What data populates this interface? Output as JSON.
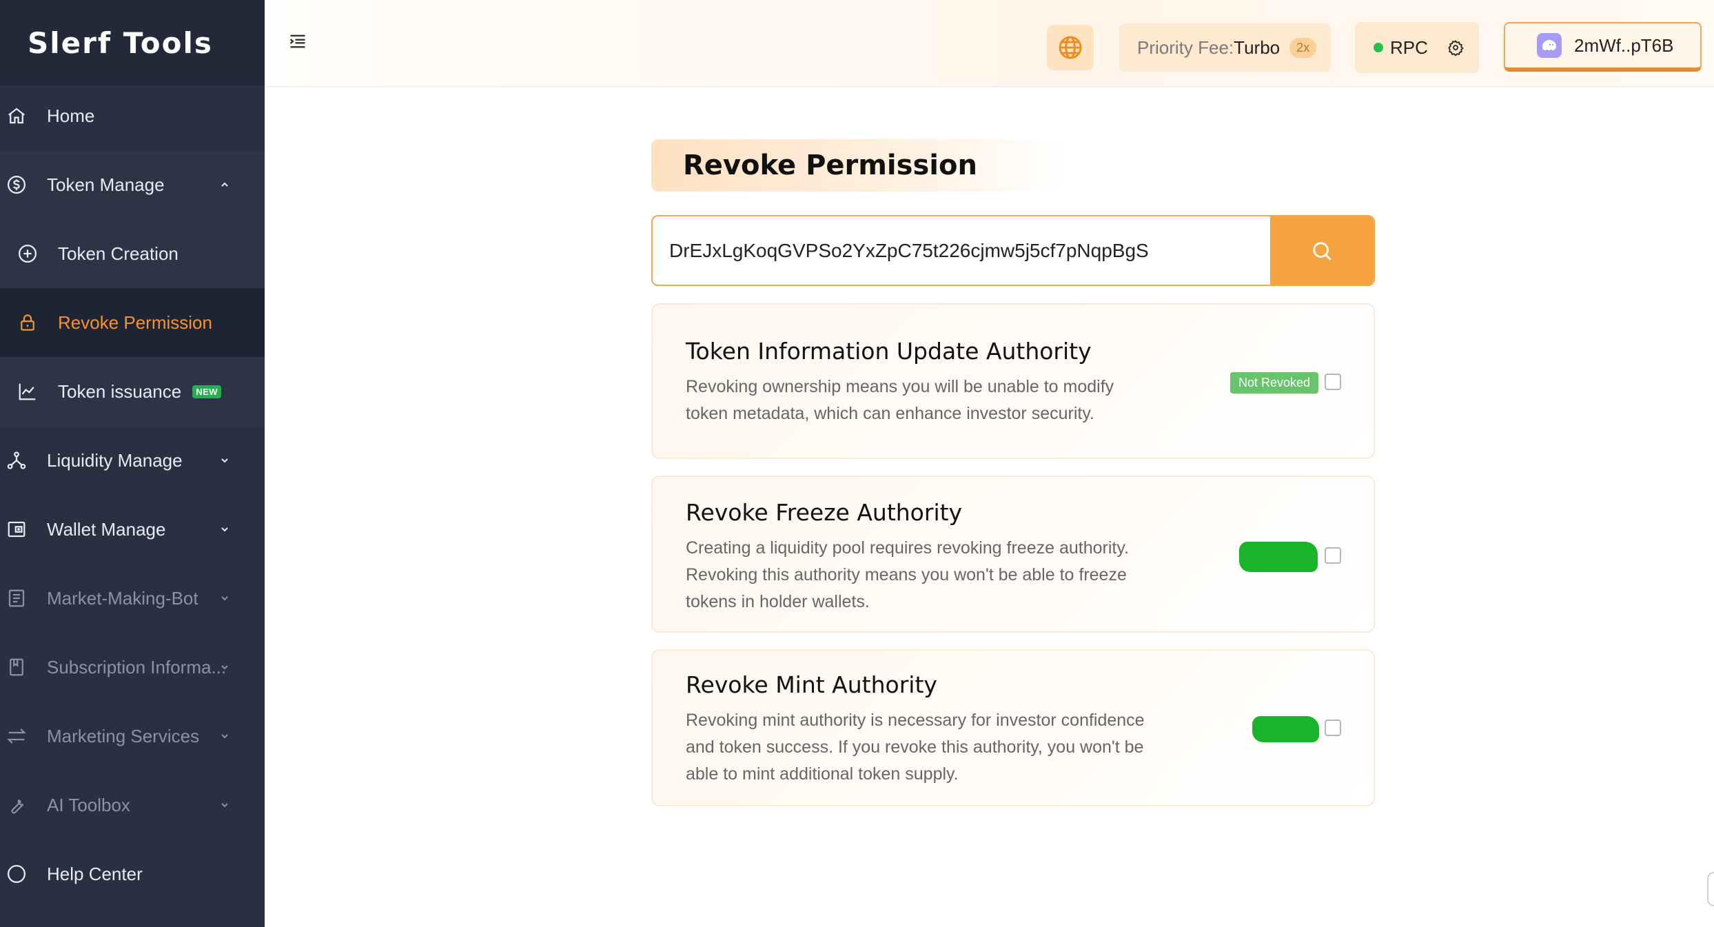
{
  "app": {
    "logo": "Slerf Tools"
  },
  "sidebar": {
    "items": [
      {
        "label": "Home",
        "icon": "home-icon"
      },
      {
        "label": "Token Manage",
        "icon": "dollar-circle-icon"
      },
      {
        "label": "Token Creation",
        "icon": "plus-circle-icon"
      },
      {
        "label": "Revoke Permission",
        "icon": "lock-icon"
      },
      {
        "label": "Token issuance",
        "icon": "chart-line-icon",
        "badge": "NEW"
      },
      {
        "label": "Liquidity Manage",
        "icon": "network-icon"
      },
      {
        "label": "Wallet Manage",
        "icon": "wallet-icon"
      },
      {
        "label": "Market-Making-Bot",
        "icon": "bot-icon"
      },
      {
        "label": "Subscription Informa...",
        "icon": "bookmark-icon"
      },
      {
        "label": "Marketing Services",
        "icon": "swap-icon"
      },
      {
        "label": "AI Toolbox",
        "icon": "wrench-icon"
      },
      {
        "label": "Help Center",
        "icon": "help-icon"
      }
    ]
  },
  "header": {
    "priority_fee_label": "Priority Fee:",
    "priority_fee_value": "Turbo",
    "priority_fee_multiplier": "2x",
    "rpc_label": "RPC",
    "wallet_address": "2mWf..pT6B"
  },
  "main": {
    "title": "Revoke Permission",
    "search_value": "DrEJxLgKoqGVPSo2YxZpC75t226cjmw5j5cf7pNqpBgS",
    "cards": [
      {
        "title": "Token Information Update Authority",
        "description_line1": "Revoking ownership means you will be unable to modify",
        "description_line2": "token metadata, which can enhance investor security.",
        "status": "Not Revoked"
      },
      {
        "title": "Revoke Freeze Authority",
        "description_line1": "Creating a liquidity pool requires revoking freeze authority.",
        "description_line2": "Revoking this authority means you won't be able to freeze",
        "description_line3": "tokens in holder wallets."
      },
      {
        "title": "Revoke Mint Authority",
        "description_line1": "Revoking mint authority is necessary for investor confidence",
        "description_line2": "and token success. If you revoke this authority, you won't be",
        "description_line3": "able to mint additional token supply."
      }
    ]
  },
  "colors": {
    "sidebar_bg": "#283041",
    "accent_orange": "#f5a33e",
    "active_text": "#f59332",
    "status_green": "#68c46c"
  }
}
